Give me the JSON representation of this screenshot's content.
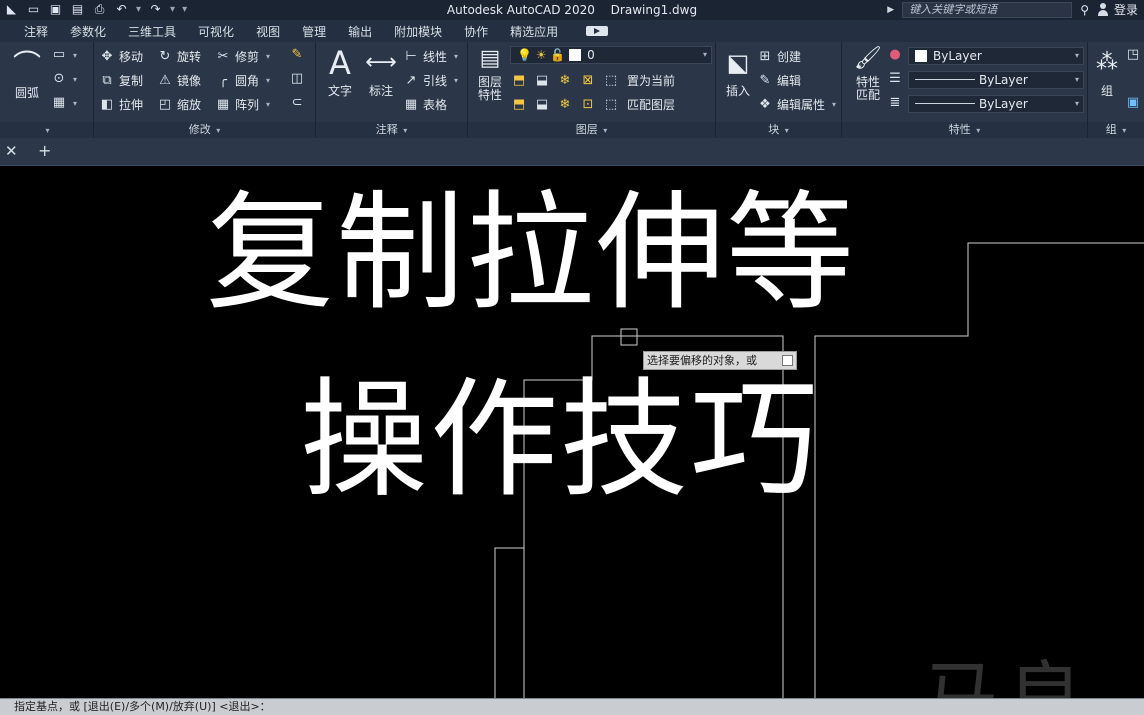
{
  "window": {
    "title_app": "Autodesk AutoCAD 2020",
    "title_file": "Drawing1.dwg",
    "search_placeholder": "键入关键字或短语",
    "login": "登录"
  },
  "menu": [
    "注释",
    "参数化",
    "三维工具",
    "可视化",
    "视图",
    "管理",
    "输出",
    "附加模块",
    "协作",
    "精选应用"
  ],
  "ribbon": {
    "draw": {
      "arc": "圆弧"
    },
    "modify": {
      "footer": "修改",
      "move": "移动",
      "rotate": "旋转",
      "trim": "修剪",
      "copy": "复制",
      "mirror": "镜像",
      "fillet": "圆角",
      "stretch": "拉伸",
      "scale": "缩放",
      "array": "阵列"
    },
    "annotation": {
      "footer": "注释",
      "text": "文字",
      "dimension": "标注",
      "linear": "线性",
      "leader": "引线",
      "table": "表格"
    },
    "layers": {
      "footer": "图层",
      "props": "图层\n特性",
      "props_1": "图层",
      "props_2": "特性",
      "current_layer": "0",
      "make_current": "置为当前",
      "match_layer": "匹配图层"
    },
    "block": {
      "footer": "块",
      "insert": "插入",
      "create": "创建",
      "edit": "编辑",
      "edit_attrs": "编辑属性"
    },
    "properties": {
      "footer": "特性",
      "match_1": "特性",
      "match_2": "匹配",
      "color": "ByLayer",
      "linetype": "ByLayer",
      "lineweight": "ByLayer"
    },
    "groups": {
      "footer": "组",
      "group": "组"
    }
  },
  "canvas": {
    "overlay_line1": "复制拉伸等",
    "overlay_line2": "操作技巧",
    "tooltip": "选择要偏移的对象，或",
    "watermark": "马良"
  },
  "command_line": "指定基点，或 [退出(E)/多个(M)/放弃(U)] <退出>："
}
